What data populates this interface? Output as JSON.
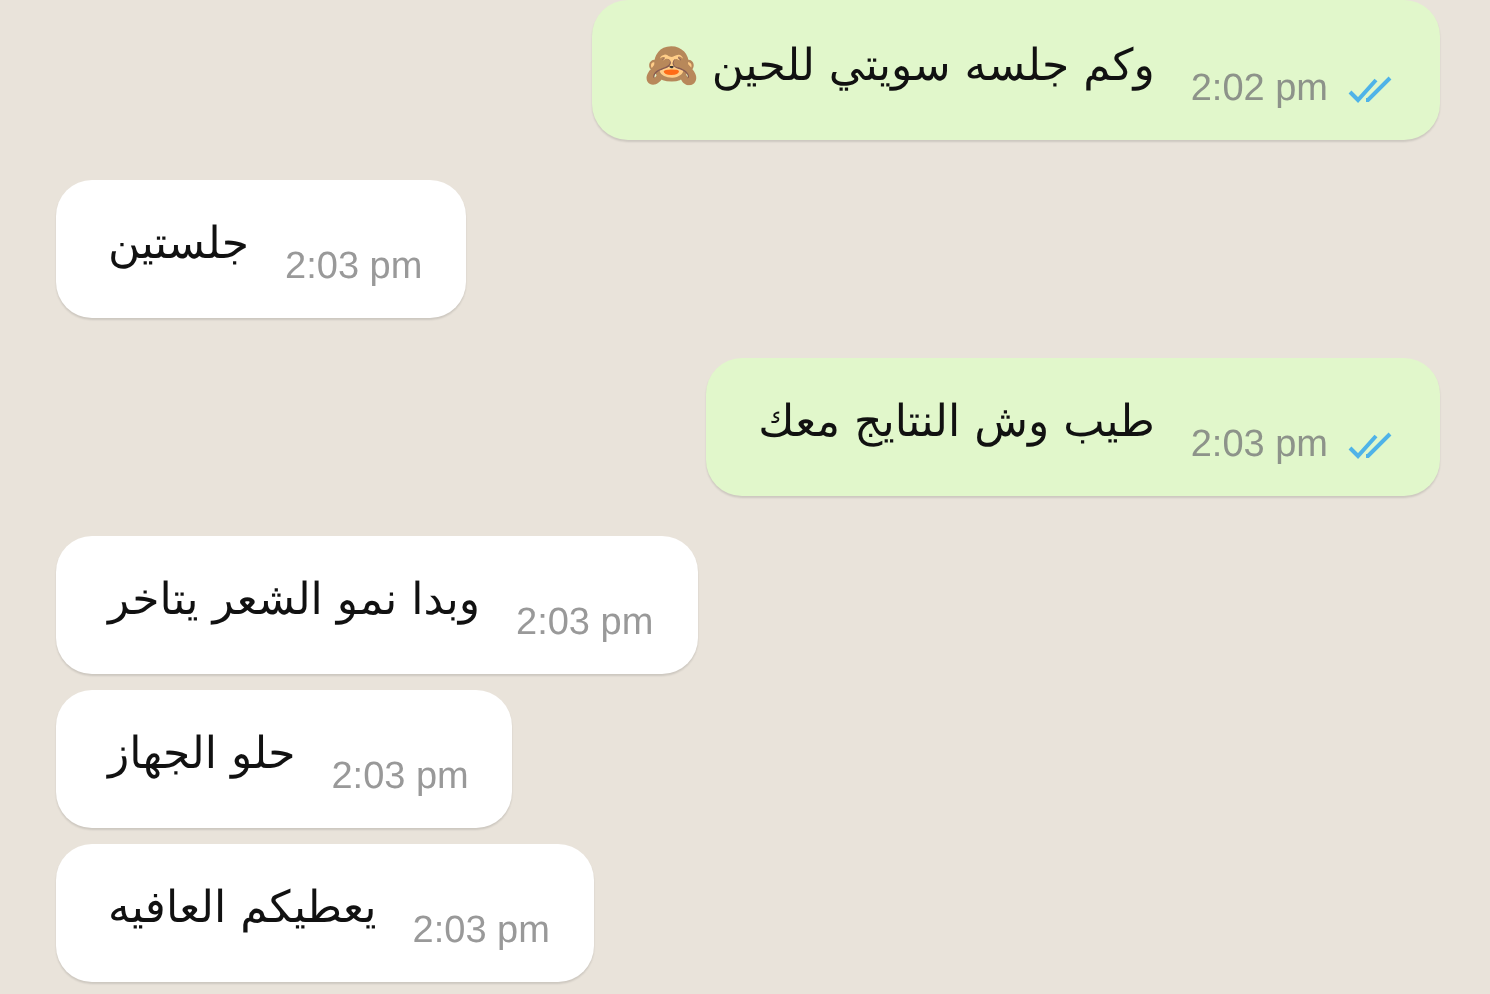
{
  "messages": [
    {
      "kind": "sent",
      "text": "وكم جلسه سويتي للحين 🙈",
      "time": "2:02 pm",
      "read": true
    },
    {
      "kind": "received",
      "text": "جلستين",
      "time": "2:03 pm"
    },
    {
      "kind": "sent",
      "text": "طيب وش النتايج معك",
      "time": "2:03 pm",
      "read": true
    },
    {
      "kind": "received",
      "text": "وبدا نمو الشعر يتاخر",
      "time": "2:03 pm"
    },
    {
      "kind": "received",
      "text": "حلو الجهاز",
      "time": "2:03 pm"
    },
    {
      "kind": "received",
      "text": "يعطيكم العافيه",
      "time": "2:03 pm"
    }
  ]
}
